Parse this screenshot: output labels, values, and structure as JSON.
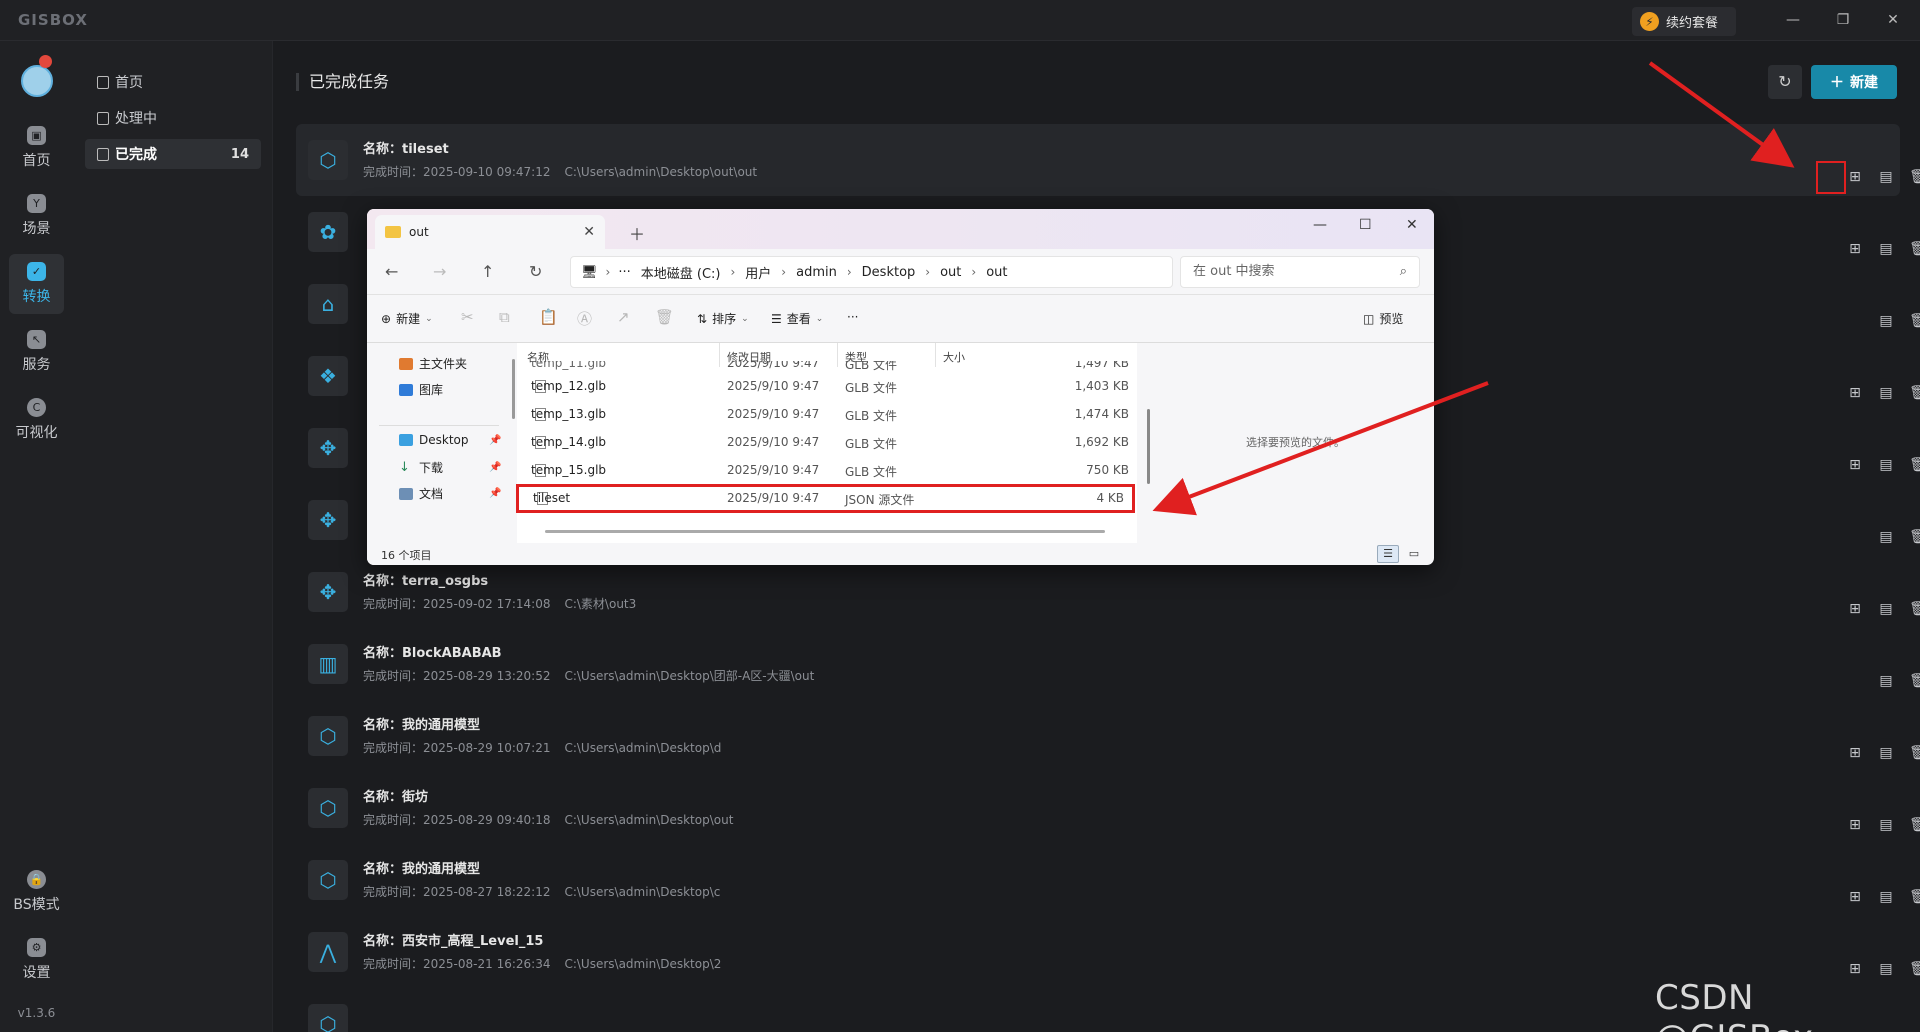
{
  "app": {
    "logo": "GISBOX",
    "renew_label": "续约套餐",
    "version": "v1.3.6"
  },
  "rail": {
    "items": [
      {
        "label": "首页",
        "icon": "home-icon"
      },
      {
        "label": "场景",
        "icon": "scene-icon"
      },
      {
        "label": "转换",
        "icon": "convert-icon",
        "active": true
      },
      {
        "label": "服务",
        "icon": "service-icon"
      },
      {
        "label": "可视化",
        "icon": "visual-icon"
      }
    ],
    "bottom": [
      {
        "label": "BS模式",
        "icon": "lock-icon"
      },
      {
        "label": "设置",
        "icon": "settings-icon"
      }
    ]
  },
  "sidebar": {
    "items": [
      {
        "label": "首页"
      },
      {
        "label": "处理中"
      },
      {
        "label": "已完成",
        "count": "14",
        "active": true
      }
    ]
  },
  "main": {
    "title": "已完成任务",
    "new_label": "新建",
    "name_prefix": "名称：",
    "time_prefix": "完成时间：",
    "tasks": [
      {
        "name": "tileset",
        "time": "2025-09-10 09:47:12",
        "path": "C:\\Users\\admin\\Desktop\\out\\out"
      },
      {
        "name": "terra_osgbs",
        "time": "2025-09-02 17:14:08",
        "path": "C:\\素材\\out3"
      },
      {
        "name": "BlockABABAB",
        "time": "2025-08-29 13:20:52",
        "path": "C:\\Users\\admin\\Desktop\\团部-A区-大疆\\out"
      },
      {
        "name": "我的通用模型",
        "time": "2025-08-29 10:07:21",
        "path": "C:\\Users\\admin\\Desktop\\d"
      },
      {
        "name": "街坊",
        "time": "2025-08-29 09:40:18",
        "path": "C:\\Users\\admin\\Desktop\\out"
      },
      {
        "name": "我的通用模型",
        "time": "2025-08-27 18:22:12",
        "path": "C:\\Users\\admin\\Desktop\\c"
      },
      {
        "name": "西安市_高程_Level_15",
        "time": "2025-08-21 16:26:34",
        "path": "C:\\Users\\admin\\Desktop\\2"
      }
    ]
  },
  "explorer": {
    "tab_title": "out",
    "breadcrumb": [
      "本地磁盘 (C:)",
      "用户",
      "admin",
      "Desktop",
      "out",
      "out"
    ],
    "search_placeholder": "在 out 中搜索",
    "cmd": {
      "new": "新建",
      "sort": "排序",
      "view": "查看",
      "preview": "预览"
    },
    "nav": [
      {
        "label": "主文件夹"
      },
      {
        "label": "图库"
      },
      {
        "label": "Desktop"
      },
      {
        "label": "下载"
      },
      {
        "label": "文档"
      }
    ],
    "columns": [
      "名称",
      "修改日期",
      "类型",
      "大小"
    ],
    "partial_row": {
      "name": "temp_11.glb",
      "date": "2025/9/10 9:47",
      "type": "GLB 文件",
      "size": "1,497 KB"
    },
    "files": [
      {
        "name": "temp_12.glb",
        "date": "2025/9/10 9:47",
        "type": "GLB 文件",
        "size": "1,403 KB"
      },
      {
        "name": "temp_13.glb",
        "date": "2025/9/10 9:47",
        "type": "GLB 文件",
        "size": "1,474 KB"
      },
      {
        "name": "temp_14.glb",
        "date": "2025/9/10 9:47",
        "type": "GLB 文件",
        "size": "1,692 KB"
      },
      {
        "name": "temp_15.glb",
        "date": "2025/9/10 9:47",
        "type": "GLB 文件",
        "size": "750 KB"
      },
      {
        "name": "tileset",
        "date": "2025/9/10 9:47",
        "type": "JSON 源文件",
        "size": "4 KB"
      }
    ],
    "preview_hint": "选择要预览的文件。",
    "status": "16 个项目"
  },
  "watermark": "CSDN @GISBox",
  "colors": {
    "accent": "#1889a8",
    "active_nav": "#3cb5e8",
    "annotation": "#e02020"
  }
}
